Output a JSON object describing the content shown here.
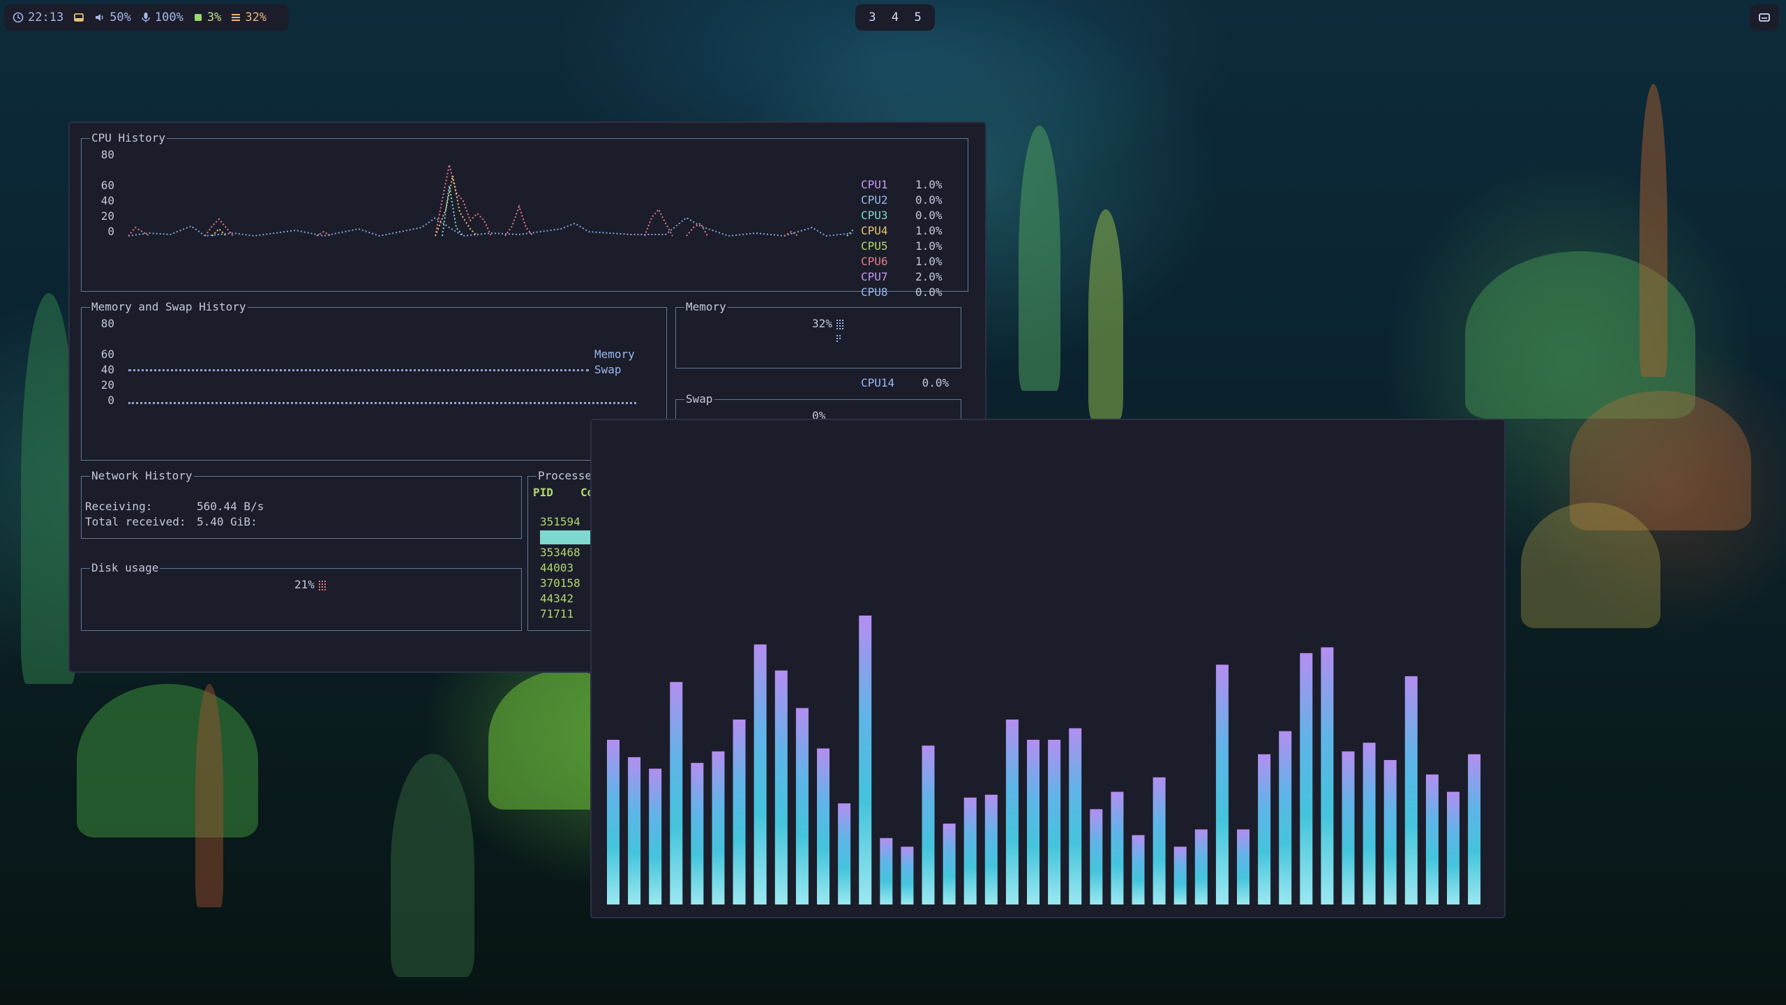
{
  "topbar": {
    "clock": "22:13",
    "volume": "50%",
    "mic": "100%",
    "cpu": "3%",
    "memory": "32%",
    "workspaces": [
      "3",
      "4",
      "5"
    ]
  },
  "btop": {
    "cpu_history": {
      "title": "CPU History",
      "y_labels": [
        "80",
        "60",
        "40",
        "20",
        "0"
      ],
      "cores": [
        {
          "name": "CPU1",
          "value": "1.0%",
          "color": "#c39af2"
        },
        {
          "name": "CPU2",
          "value": "0.0%",
          "color": "#9ab8f2"
        },
        {
          "name": "CPU3",
          "value": "0.0%",
          "color": "#7fd8d0"
        },
        {
          "name": "CPU4",
          "value": "1.0%",
          "color": "#e3c57a"
        },
        {
          "name": "CPU5",
          "value": "1.0%",
          "color": "#b3d76f"
        },
        {
          "name": "CPU6",
          "value": "1.0%",
          "color": "#e37a8a"
        },
        {
          "name": "CPU7",
          "value": "2.0%",
          "color": "#c39af2"
        },
        {
          "name": "CPU8",
          "value": "0.0%",
          "color": "#9ab8f2"
        }
      ],
      "extra_core": {
        "name": "CPU14",
        "value": "0.0%"
      }
    },
    "memory_history": {
      "title": "Memory and Swap History",
      "y_labels": [
        "80",
        "60",
        "40",
        "20",
        "0"
      ],
      "legend": [
        "Memory",
        "Swap"
      ]
    },
    "memory": {
      "title": "Memory",
      "value": "32%"
    },
    "swap": {
      "title": "Swap",
      "value": "0%"
    },
    "network": {
      "title": "Network History",
      "receiving_label": "Receiving:",
      "receiving_value": "560.44  B/s",
      "total_label": "Total received:",
      "total_value": "5.40 GiB:"
    },
    "processes": {
      "title": "Processes",
      "col_pid": "PID",
      "col_cmd": "Co",
      "pids": [
        "351594",
        "353468",
        "44003",
        "370158",
        "44342",
        "71711"
      ]
    },
    "disk": {
      "title": "Disk usage",
      "value": "21%"
    }
  },
  "visualizer": {
    "levels": [
      0.57,
      0.51,
      0.47,
      0.77,
      0.49,
      0.53,
      0.64,
      0.9,
      0.81,
      0.68,
      0.54,
      0.35,
      1.0,
      0.23,
      0.2,
      0.55,
      0.28,
      0.37,
      0.38,
      0.64,
      0.57,
      0.57,
      0.61,
      0.33,
      0.39,
      0.24,
      0.44,
      0.2,
      0.26,
      0.83,
      0.26,
      0.52,
      0.6,
      0.87,
      0.89,
      0.53,
      0.56,
      0.5,
      0.79,
      0.45,
      0.39,
      0.52
    ],
    "gradient": [
      "#b48ef0",
      "#5fb4e8",
      "#44c4dc",
      "#9be8f0"
    ]
  }
}
